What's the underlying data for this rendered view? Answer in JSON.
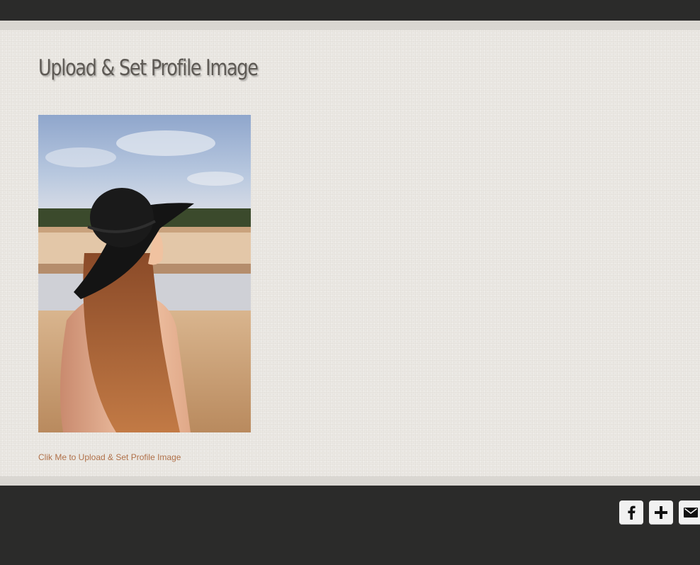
{
  "page": {
    "title": "Upload & Set Profile Image",
    "upload_link": "Clik Me to Upload & Set Profile Image"
  },
  "profile_image": {
    "depicts": "woman-in-black-hat-on-beach-photo"
  },
  "footer": {
    "share_buttons": [
      {
        "icon": "facebook-icon"
      },
      {
        "icon": "plus-icon"
      },
      {
        "icon": "envelope-icon"
      }
    ]
  },
  "colors": {
    "background": "#ebe8e3",
    "dark_bar": "#2b2b2a",
    "title": "#5e5a55",
    "link": "#b0714a"
  }
}
